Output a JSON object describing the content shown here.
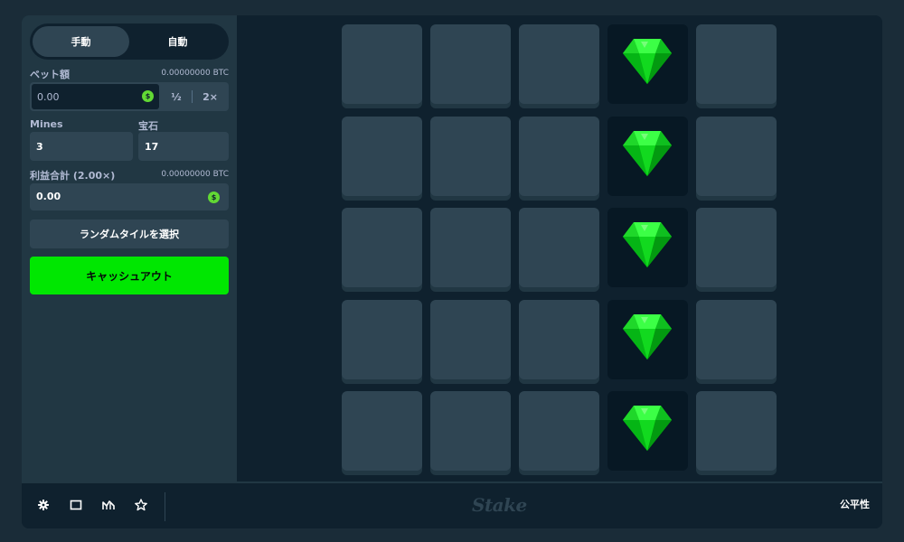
{
  "sidebar": {
    "mode_tabs": [
      {
        "label": "手動",
        "active": true
      },
      {
        "label": "自動",
        "active": false
      }
    ],
    "bet": {
      "label": "ベット額",
      "balance": "0.00000000 BTC",
      "value": "0.00",
      "half_label": "½",
      "double_label": "2×"
    },
    "mines": {
      "label": "Mines",
      "value": "3"
    },
    "gems": {
      "label": "宝石",
      "value": "17"
    },
    "profit": {
      "label": "利益合計 (2.00×)",
      "balance": "0.00000000 BTC",
      "value": "0.00"
    },
    "random_tile_button": "ランダムタイルを選択",
    "cashout_button": "キャッシュアウト"
  },
  "grid": {
    "columns": 5,
    "rows": 5,
    "revealed_column": 3,
    "revealed_icon": "gem-icon"
  },
  "footer": {
    "icons": [
      "settings-icon",
      "theatre-mode-icon",
      "stats-icon",
      "favorite-icon"
    ],
    "brand": "Stake",
    "fairness_label": "公平性"
  },
  "colors": {
    "accent_green": "#00e701",
    "panel": "#213743",
    "tile": "#2f4553",
    "background": "#0f212e",
    "gem": "#00e701"
  }
}
